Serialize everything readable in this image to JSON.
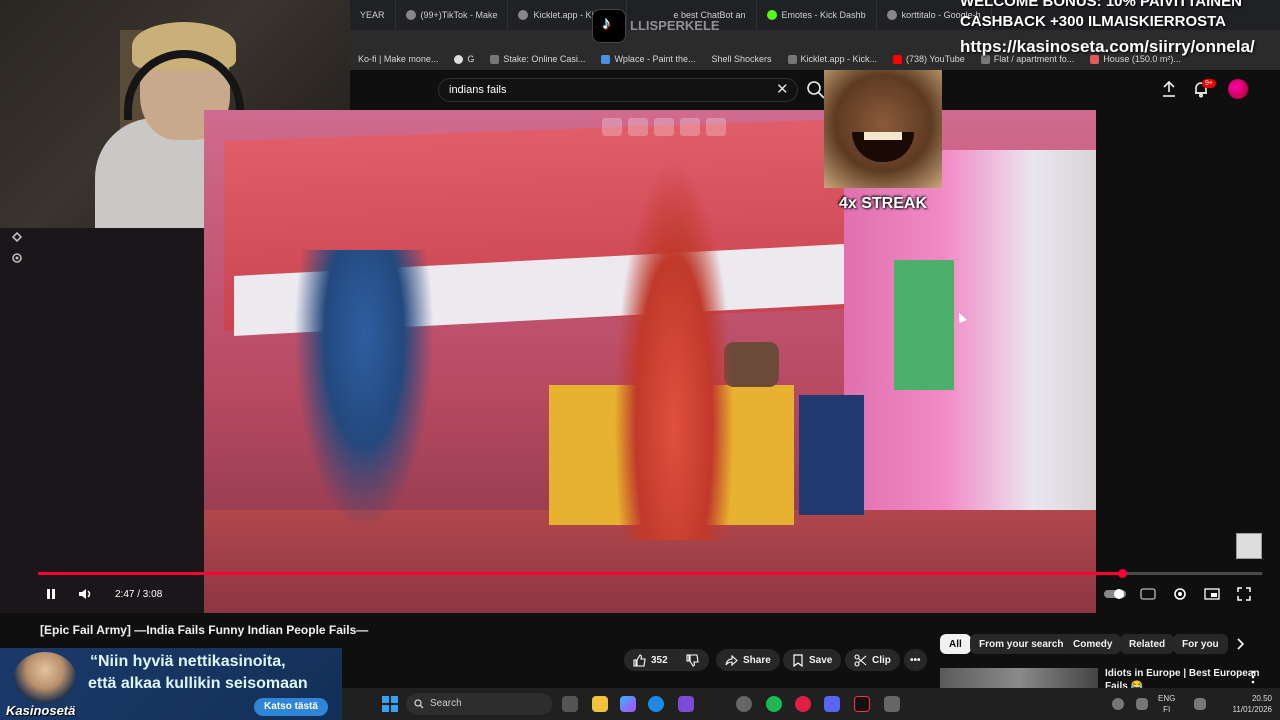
{
  "browser_tabs": [
    "YEAR",
    "(99+)TikTok - Make",
    "Kicklet.app - Kick Ch",
    "e best ChatBot an",
    "Emotes - Kick Dashb",
    "korttitalo - Google-h"
  ],
  "bookmarks": [
    "Ko-fi | Make mone...",
    "G",
    "Stake: Online Casi...",
    "Wplace - Paint the...",
    "Shell Shockers",
    "Kicklet.app - Kick...",
    "(738) YouTube",
    "Flat / apartment fo...",
    "House (150.0 m²)..."
  ],
  "youtube": {
    "search_value": "indians fails",
    "notification_count": "9+"
  },
  "overlay": {
    "promo_line1": "WELCOME BONUS: 10% PAIVITTAINEN",
    "promo_line2": "CASHBACK +300 ILMAISKIERROSTA",
    "promo_url": "https://kasinoseta.com/siirry/onnela/",
    "streak_label": "4x STREAK",
    "channel_watermark": "LLISPERKELE"
  },
  "player": {
    "time_display": "2:47 / 3:08",
    "progress_fraction": 0.886
  },
  "video": {
    "title": "[Epic Fail Army] —India Fails Funny Indian People Fails—",
    "like_count": "352",
    "share_label": "Share",
    "save_label": "Save",
    "clip_label": "Clip"
  },
  "filter_chips": [
    "All",
    "From your search",
    "Comedy",
    "Related",
    "For you"
  ],
  "recommendation": {
    "title": "Idiots in Europe | Best European",
    "title_line2": "Fails 😂"
  },
  "ad": {
    "quote_line1": "“Niin hyviä nettikasinoita,",
    "quote_line2": "että alkaa kullikin seisomaan",
    "button_label": "Katso tästä",
    "brand": "Kasinosetä"
  },
  "taskbar": {
    "search_placeholder": "Search",
    "lang_line1": "ENG",
    "lang_line2": "FI",
    "clock_time": "20.50",
    "clock_date": "11/01/2026"
  },
  "colors": {
    "progress": "#ff0033",
    "youtube_bg": "#0f0f0f",
    "ad_bg": "#1b3a6b"
  }
}
